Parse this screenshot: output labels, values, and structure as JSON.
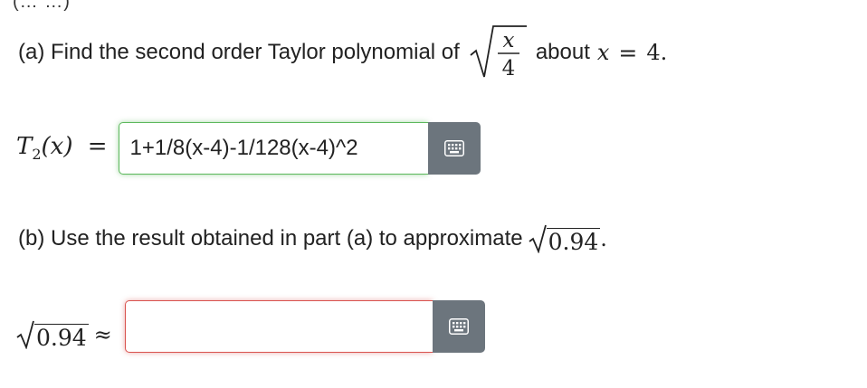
{
  "top_fragment": "(… …)",
  "part_a": {
    "prefix": "(a) Find the second order Taylor polynomial of",
    "frac_numerator": "x",
    "frac_denominator": "4",
    "about_text": "about",
    "about_var": "x",
    "about_eq": "=",
    "about_value": "4."
  },
  "t2": {
    "label_T": "T",
    "label_sub": "2",
    "label_arg": "(x)",
    "label_eq": "=",
    "input_value": "1+1/8(x-4)-1/128(x-4)^2",
    "input_status": "correct",
    "keyboard_icon": "keyboard-icon"
  },
  "part_b": {
    "prefix": "(b) Use the result obtained in part (a) to approximate",
    "radicand": "0.94",
    "suffix": "."
  },
  "approx": {
    "radicand": "0.94",
    "symbol": "≈",
    "input_value": "",
    "input_status": "incorrect",
    "keyboard_icon": "keyboard-icon"
  },
  "colors": {
    "correct_border": "#5cb85c",
    "incorrect_border": "#d9534f",
    "keyboard_button": "#6c757d"
  }
}
